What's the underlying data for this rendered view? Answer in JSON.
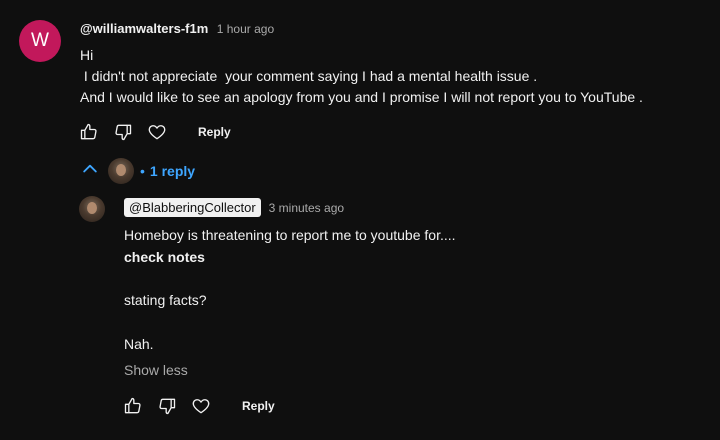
{
  "comment": {
    "avatar_letter": "W",
    "avatar_color": "#c2185b",
    "author": "@williamwalters-f1m",
    "time": "1 hour ago",
    "lines": [
      "Hi",
      " I didn't not appreciate  your comment saying I had a mental health issue .",
      "And I would like to see an apology from you and I promise I will not report you to YouTube ."
    ],
    "reply_label": "Reply"
  },
  "replies_toggle": {
    "separator": "•",
    "count_label": "1 reply"
  },
  "reply": {
    "author": "@BlabberingCollector",
    "time": "3 minutes ago",
    "lines": [
      "Homeboy is threatening to report me to youtube for....",
      "check notes",
      "stating facts?",
      "Nah."
    ],
    "show_less": "Show less",
    "reply_label": "Reply"
  },
  "colors": {
    "background": "#0f0f0f",
    "text": "#f1f1f1",
    "secondary": "#aaaaaa",
    "link_blue": "#3ea6ff"
  },
  "icons": [
    "like-icon",
    "dislike-icon",
    "heart-icon",
    "chevron-up-icon"
  ]
}
